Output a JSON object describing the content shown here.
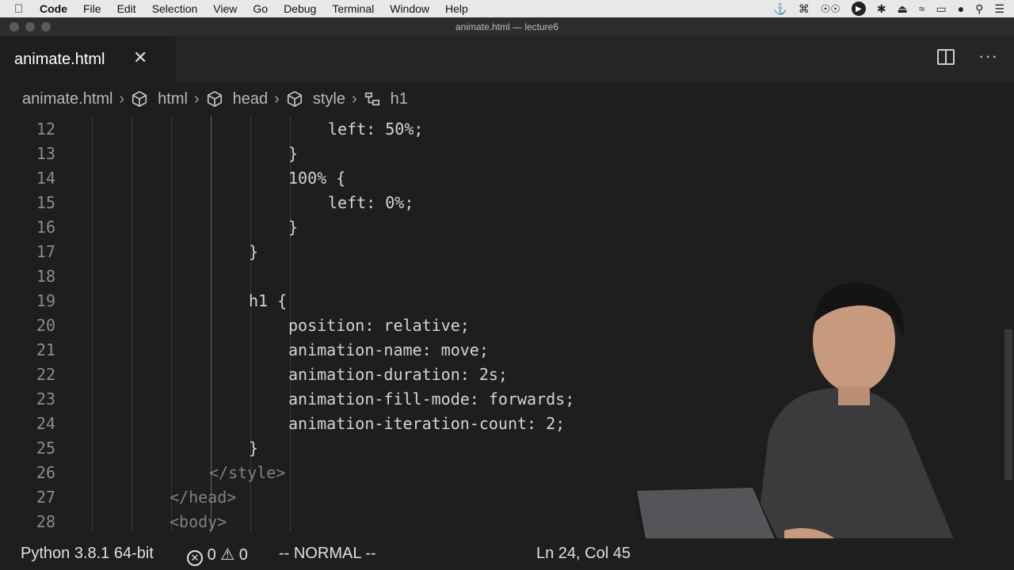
{
  "menubar": {
    "app": "Code",
    "items": [
      "File",
      "Edit",
      "Selection",
      "View",
      "Go",
      "Debug",
      "Terminal",
      "Window",
      "Help"
    ]
  },
  "window": {
    "title": "animate.html — lecture6"
  },
  "tab": {
    "label": "animate.html",
    "close": "✕"
  },
  "breadcrumb": [
    "animate.html",
    "html",
    "head",
    "style",
    "h1"
  ],
  "editor": {
    "lines": [
      {
        "num": "12",
        "indent": 7,
        "text": "left: 50%;"
      },
      {
        "num": "13",
        "indent": 6,
        "text": "}"
      },
      {
        "num": "14",
        "indent": 6,
        "text": "100% {"
      },
      {
        "num": "15",
        "indent": 7,
        "text": "left: 0%;"
      },
      {
        "num": "16",
        "indent": 6,
        "text": "}"
      },
      {
        "num": "17",
        "indent": 5,
        "text": "}"
      },
      {
        "num": "18",
        "indent": 0,
        "text": ""
      },
      {
        "num": "19",
        "indent": 5,
        "text": "h1 {"
      },
      {
        "num": "20",
        "indent": 6,
        "text": "position: relative;"
      },
      {
        "num": "21",
        "indent": 6,
        "text": "animation-name: move;"
      },
      {
        "num": "22",
        "indent": 6,
        "text": "animation-duration: 2s;"
      },
      {
        "num": "23",
        "indent": 6,
        "text": "animation-fill-mode: forwards;"
      },
      {
        "num": "24",
        "indent": 6,
        "text": "animation-iteration-count: 2;"
      },
      {
        "num": "25",
        "indent": 5,
        "text": "}"
      },
      {
        "num": "26",
        "indent": 4,
        "text": "</style>"
      },
      {
        "num": "27",
        "indent": 3,
        "text": "</head>"
      },
      {
        "num": "28",
        "indent": 3,
        "text": "<body>"
      }
    ]
  },
  "status": {
    "python": "Python 3.8.1 64-bit",
    "errors": "0",
    "warnings": "0",
    "mode": "-- NORMAL --",
    "position": "Ln 24, Col 45"
  }
}
